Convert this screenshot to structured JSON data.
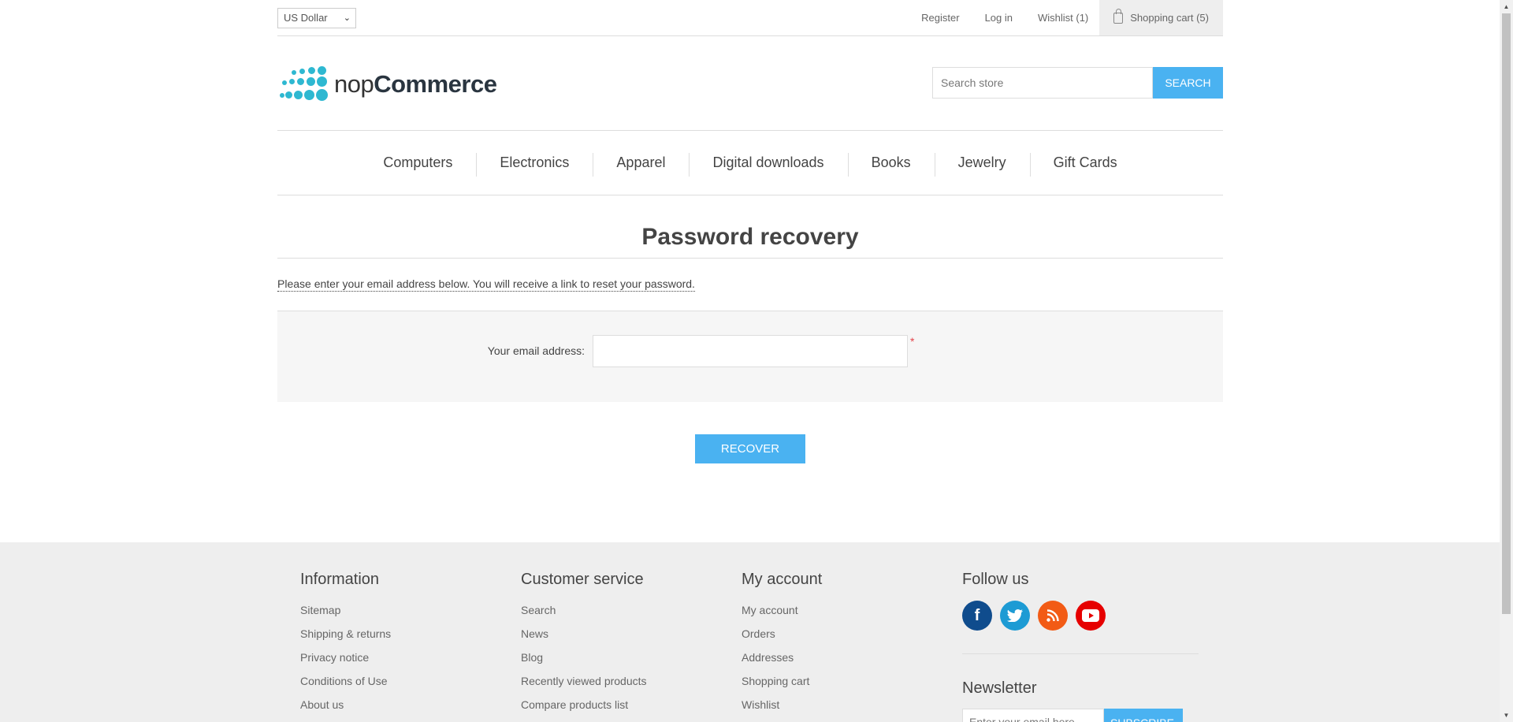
{
  "header": {
    "currency": "US Dollar",
    "links": {
      "register": "Register",
      "login": "Log in",
      "wishlist": "Wishlist (1)",
      "cart": "Shopping cart (5)"
    }
  },
  "logo": {
    "part1": "nop",
    "part2": "Commerce"
  },
  "search": {
    "placeholder": "Search store",
    "button": "SEARCH"
  },
  "menu": [
    "Computers",
    "Electronics",
    "Apparel",
    "Digital downloads",
    "Books",
    "Jewelry",
    "Gift Cards"
  ],
  "main": {
    "title": "Password recovery",
    "tip": "Please enter your email address below. You will receive a link to reset your password.",
    "email_label": "Your email address:",
    "email_value": "",
    "required_mark": "*",
    "recover_button": "RECOVER"
  },
  "footer": {
    "information": {
      "title": "Information",
      "items": [
        "Sitemap",
        "Shipping & returns",
        "Privacy notice",
        "Conditions of Use",
        "About us"
      ]
    },
    "customer_service": {
      "title": "Customer service",
      "items": [
        "Search",
        "News",
        "Blog",
        "Recently viewed products",
        "Compare products list"
      ]
    },
    "my_account": {
      "title": "My account",
      "items": [
        "My account",
        "Orders",
        "Addresses",
        "Shopping cart",
        "Wishlist"
      ]
    },
    "follow_us": {
      "title": "Follow us",
      "social": [
        {
          "name": "facebook-icon",
          "glyph": "f",
          "color": "#0f4c8d"
        },
        {
          "name": "twitter-icon",
          "glyph": "",
          "color": "#1d9bd4"
        },
        {
          "name": "rss-icon",
          "glyph": "",
          "color": "#f25b15"
        },
        {
          "name": "youtube-icon",
          "glyph": "",
          "color": "#e60000"
        }
      ]
    },
    "newsletter": {
      "title": "Newsletter",
      "placeholder": "Enter your email here...",
      "button": "SUBSCRIBE"
    }
  },
  "colors": {
    "accent": "#4ab2f1",
    "logo": "#2eb8d1",
    "required": "#e4434b"
  }
}
